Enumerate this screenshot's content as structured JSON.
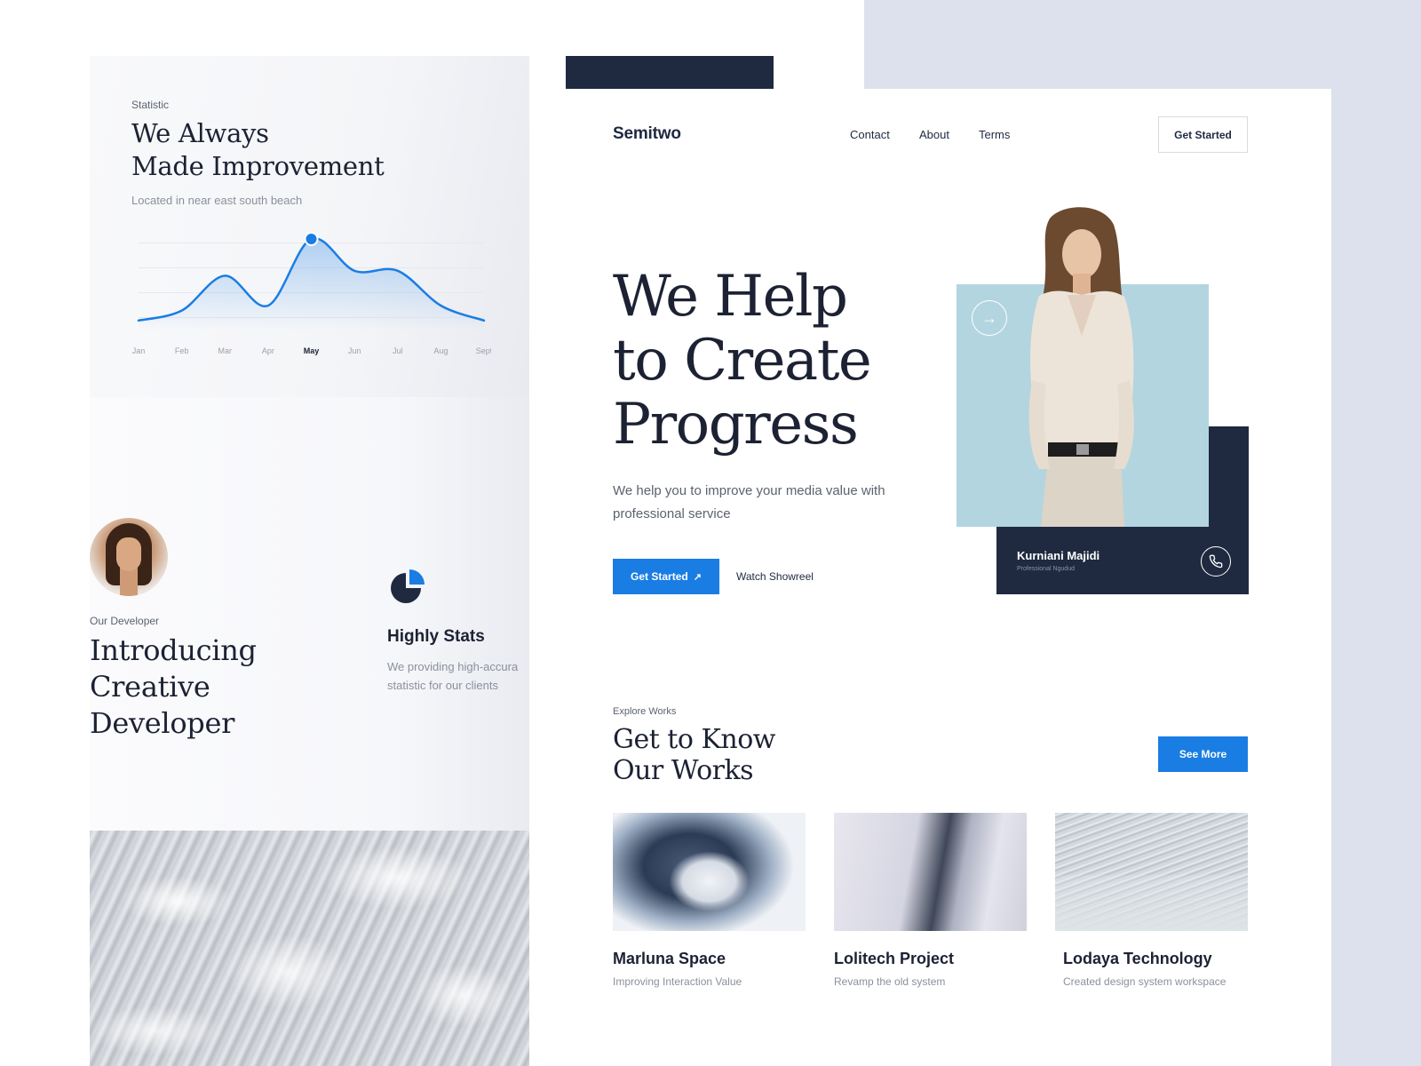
{
  "left_panel": {
    "statistic": {
      "eyebrow": "Statistic",
      "title_line1": "We Always",
      "title_line2": "Made Improvement",
      "subtitle": "Located in near east south beach"
    },
    "developer": {
      "eyebrow": "Our Developer",
      "title_line1": "Introducing",
      "title_line2": "Creative",
      "title_line3": "Developer"
    },
    "stats_feature": {
      "title": "Highly Stats",
      "desc_line1": "We providing high-accura",
      "desc_line2": "statistic for our clients",
      "icon": "pie-chart-icon"
    }
  },
  "chart_data": {
    "type": "line",
    "categories": [
      "Jan",
      "Feb",
      "Mar",
      "Apr",
      "May",
      "Jun",
      "Jul",
      "Aug",
      "Sept"
    ],
    "values": [
      10,
      20,
      55,
      25,
      92,
      60,
      60,
      25,
      10
    ],
    "highlight_index": 4,
    "ylim": [
      0,
      100
    ],
    "grid": true,
    "title": "",
    "xlabel": "",
    "ylabel": "",
    "colors": {
      "line": "#1a7de3",
      "fill": "#cfe2f8"
    }
  },
  "header": {
    "logo": "Semitwo",
    "nav": {
      "contact": "Contact",
      "about": "About",
      "terms": "Terms"
    },
    "cta": "Get Started"
  },
  "hero": {
    "title_line1": "We Help",
    "title_line2": "to Create",
    "title_line3": "Progress",
    "desc": "We help you to improve your media value with professional service",
    "primary_cta": "Get Started",
    "primary_cta_icon": "arrow-up-right-icon",
    "secondary_cta": "Watch Showreel"
  },
  "profile": {
    "name": "Kurniani Majidi",
    "role": "Professional Ngudud",
    "arrow_icon": "arrow-right-icon",
    "phone_icon": "phone-icon"
  },
  "works": {
    "eyebrow": "Explore Works",
    "title_line1": "Get to Know",
    "title_line2": "Our Works",
    "see_more": "See More",
    "items": [
      {
        "title": "Marluna Space",
        "subtitle": "Improving Interaction Value"
      },
      {
        "title": "Lolitech Project",
        "subtitle": "Revamp the old system"
      },
      {
        "title": "Lodaya Technology",
        "subtitle": "Created design system workspace"
      }
    ]
  },
  "colors": {
    "accent": "#1a7de3",
    "navy": "#1f2a40",
    "light_blue": "#b3d5e0",
    "backdrop": "#dde1ed"
  }
}
